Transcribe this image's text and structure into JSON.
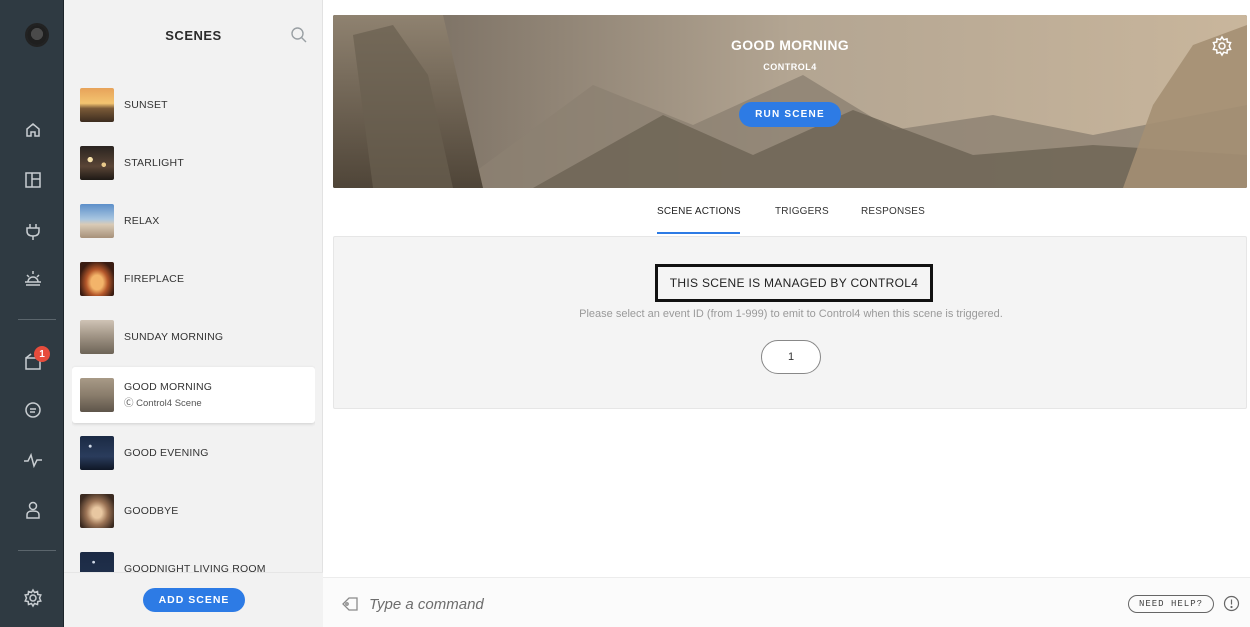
{
  "rail": {
    "notification_count": "1",
    "icons": [
      "home-icon",
      "rooms-icon",
      "devices-icon",
      "scenes-icon",
      "inbox-icon",
      "messages-icon",
      "activity-icon",
      "user-icon",
      "settings-icon"
    ]
  },
  "scenes_panel": {
    "title": "SCENES",
    "items": [
      {
        "name": "SUNSET",
        "sub": ""
      },
      {
        "name": "STARLIGHT",
        "sub": ""
      },
      {
        "name": "RELAX",
        "sub": ""
      },
      {
        "name": "FIREPLACE",
        "sub": ""
      },
      {
        "name": "SUNDAY MORNING",
        "sub": ""
      },
      {
        "name": "GOOD MORNING",
        "sub": "Control4 Scene"
      },
      {
        "name": "GOOD EVENING",
        "sub": ""
      },
      {
        "name": "GOODBYE",
        "sub": ""
      },
      {
        "name": "GOODNIGHT LIVING ROOM",
        "sub": ""
      }
    ],
    "add_label": "ADD SCENE"
  },
  "hero": {
    "title": "GOOD MORNING",
    "subtitle": "CONTROL4",
    "run_label": "RUN SCENE"
  },
  "tabs": [
    {
      "label": "SCENE ACTIONS"
    },
    {
      "label": "TRIGGERS"
    },
    {
      "label": "RESPONSES"
    }
  ],
  "card": {
    "managed_text": "THIS SCENE IS MANAGED BY CONTROL4",
    "instruction": "Please select an event ID (from 1-999) to emit to Control4 when this scene is triggered.",
    "event_id": "1"
  },
  "command": {
    "placeholder": "Type a command",
    "help_label": "NEED HELP?"
  },
  "colors": {
    "accent": "#2d7be5",
    "rail_bg": "#2f3a42",
    "badge": "#e74c3c"
  }
}
